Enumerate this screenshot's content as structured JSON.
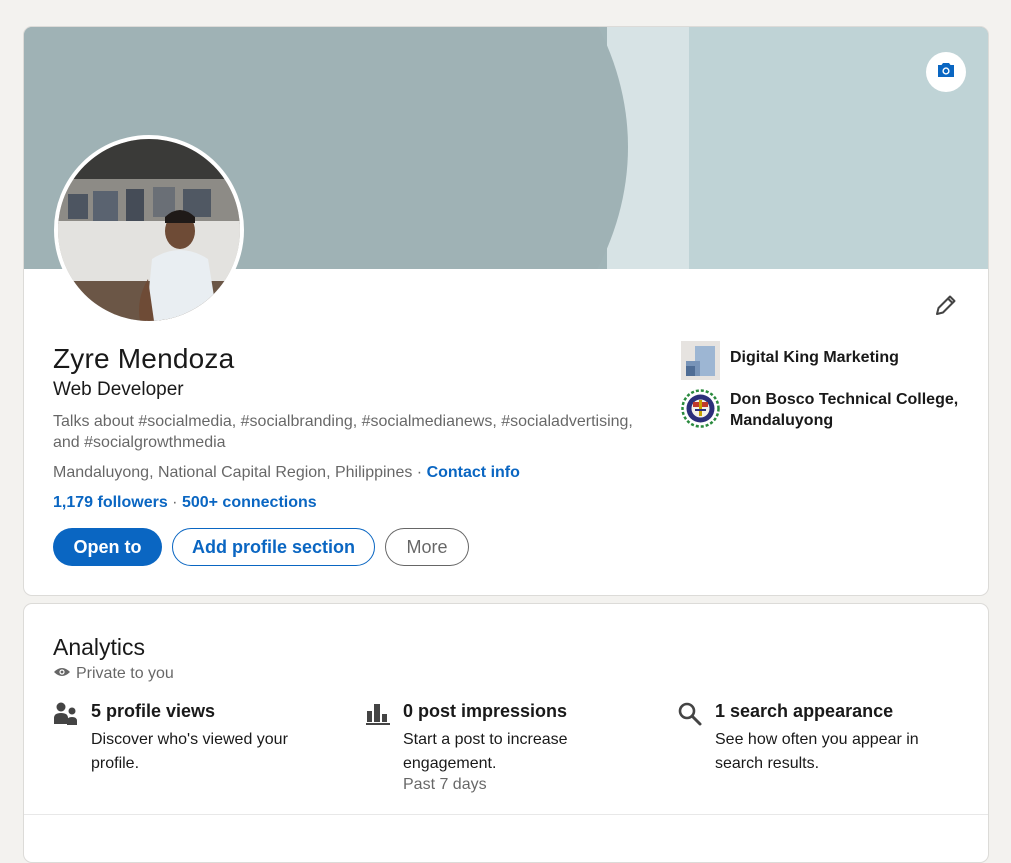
{
  "profile": {
    "name": "Zyre Mendoza",
    "headline": "Web Developer",
    "talks_about": "Talks about #socialmedia, #socialbranding, #socialmedianews, #socialadvertising, and #socialgrowthmedia",
    "location": "Mandaluyong, National Capital Region, Philippines",
    "location_separator": " · ",
    "contact_info_label": "Contact info",
    "followers": "1,179 followers",
    "stats_separator": " · ",
    "connections": "500+ connections",
    "buttons": {
      "open_to": "Open to",
      "add_section": "Add profile section",
      "more": "More"
    },
    "organizations": [
      {
        "name": "Digital King Marketing",
        "logo_icon": "digital-king-logo"
      },
      {
        "name": "Don Bosco Technical College, Mandaluyong",
        "logo_icon": "don-bosco-logo"
      }
    ],
    "cover_camera_icon": "camera-icon",
    "edit_icon": "pencil-icon"
  },
  "analytics": {
    "title": "Analytics",
    "privacy": "Private to you",
    "metrics": [
      {
        "icon": "people-icon",
        "title": "5 profile views",
        "description": "Discover who's viewed your profile."
      },
      {
        "icon": "bar-chart-icon",
        "title": "0 post impressions",
        "description": "Start a post to increase engagement.",
        "subtext": "Past 7 days"
      },
      {
        "icon": "search-icon",
        "title": "1 search appearance",
        "description": "See how often you appear in search results."
      }
    ]
  },
  "colors": {
    "accent": "#0a66c2",
    "background": "#f3f2ef",
    "cover": "#a0b4b7"
  }
}
